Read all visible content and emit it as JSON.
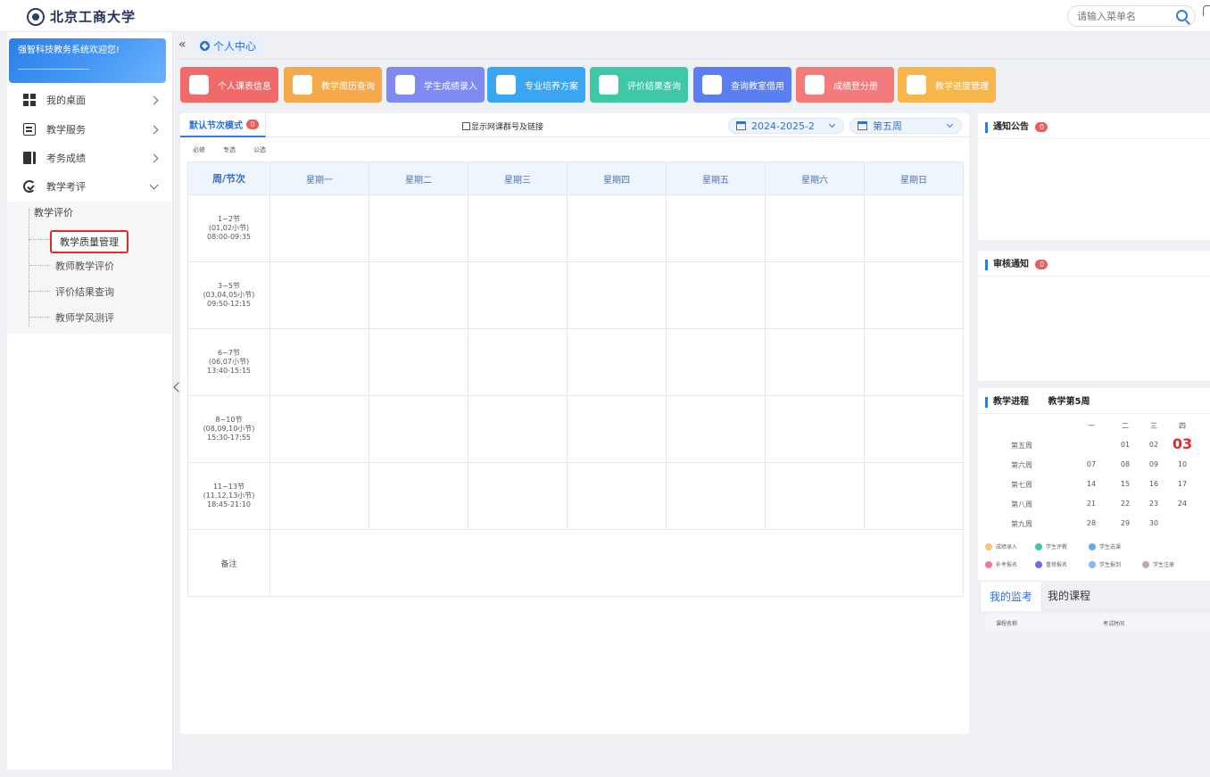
{
  "header": {
    "logo_text": "北京工商大学",
    "search_placeholder": "请输入菜单名"
  },
  "sidebar": {
    "welcome": "强智科技教务系统欢迎您!",
    "items": [
      {
        "label": "我的桌面",
        "icon": "windows-icon"
      },
      {
        "label": "教学服务",
        "icon": "list-icon"
      },
      {
        "label": "考务成绩",
        "icon": "book-icon"
      },
      {
        "label": "教学考评",
        "icon": "eval-icon"
      }
    ],
    "sub_head": "教学评价",
    "sub_items": [
      "教学质量管理",
      "教师教学评价",
      "评价结果查询",
      "教师学风测评"
    ],
    "active_sub": "教学质量管理"
  },
  "breadcrumb": {
    "home_tag": "个人中心"
  },
  "quick_buttons": [
    {
      "label": "个人课表信息",
      "color": "#f06a6a"
    },
    {
      "label": "教学周历查询",
      "color": "#f5a94a"
    },
    {
      "label": "学生成绩录入",
      "color": "#7f8bf0"
    },
    {
      "label": "专业培养方案",
      "color": "#3aa6f2"
    },
    {
      "label": "评价结果查询",
      "color": "#3ec8a8"
    },
    {
      "label": "查询教室借用",
      "color": "#5b7ff0"
    },
    {
      "label": "成绩登分册",
      "color": "#f27a7a"
    },
    {
      "label": "教学进度管理",
      "color": "#f7b64b"
    }
  ],
  "schedule": {
    "mode_tab": "默认节次模式",
    "mode_badge": "0",
    "show_checkbox_label": "显示网课群号及链接",
    "term_select": "2024-2025-2",
    "week_select": "第五周",
    "legend": [
      "必修",
      "专选",
      "公选"
    ],
    "columns": [
      "周/节次",
      "星期一",
      "星期二",
      "星期三",
      "星期四",
      "星期五",
      "星期六",
      "星期日"
    ],
    "slots": [
      {
        "name": "1~2节",
        "sub": "(01,02小节)",
        "time": "08:00-09:35"
      },
      {
        "name": "3~5节",
        "sub": "(03,04,05小节)",
        "time": "09:50-12:15"
      },
      {
        "name": "6~7节",
        "sub": "(06,07小节)",
        "time": "13:40-15:15"
      },
      {
        "name": "8~10节",
        "sub": "(08,09,10小节)",
        "time": "15:30-17:55"
      },
      {
        "name": "11~13节",
        "sub": "(11,12,13小节)",
        "time": "18:45-21:10"
      }
    ],
    "remark": "备注"
  },
  "notice": {
    "title": "通知公告",
    "badge": "0"
  },
  "audit": {
    "title": "审核通知",
    "badge": "0"
  },
  "progress": {
    "title": "教学进程",
    "current_week": "教学第5周",
    "day_headers": [
      "一",
      "二",
      "三",
      "四"
    ],
    "rows": [
      {
        "week": "第五周",
        "days": [
          "",
          "01",
          "02",
          "03"
        ]
      },
      {
        "week": "第六周",
        "days": [
          "07",
          "08",
          "09",
          "10"
        ]
      },
      {
        "week": "第七周",
        "days": [
          "14",
          "15",
          "16",
          "17"
        ]
      },
      {
        "week": "第八周",
        "days": [
          "21",
          "22",
          "23",
          "24"
        ]
      },
      {
        "week": "第九周",
        "days": [
          "28",
          "29",
          "30",
          ""
        ]
      }
    ],
    "legend": [
      {
        "label": "成绩录入",
        "color": "#f7c27a"
      },
      {
        "label": "学生评教",
        "color": "#3ec8a8"
      },
      {
        "label": "学生选课",
        "color": "#6aa7f0"
      },
      {
        "label": "补考报名",
        "color": "#f27a9a"
      },
      {
        "label": "重修报名",
        "color": "#6f6af0"
      },
      {
        "label": "学生报到",
        "color": "#8ab8e8"
      },
      {
        "label": "学生注册",
        "color": "#c0a8a8"
      }
    ]
  },
  "bottom_tabs": {
    "tab1": "我的监考",
    "tab2": "我的课程",
    "col1": "课程名称",
    "col2": "考试时间"
  }
}
